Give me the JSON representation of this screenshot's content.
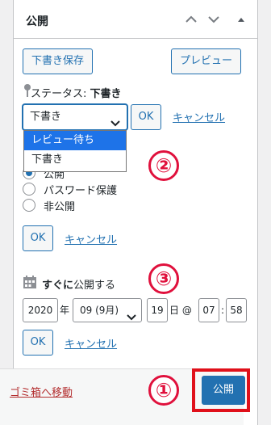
{
  "header": {
    "title": "公開"
  },
  "actions": {
    "save_draft": "下書き保存",
    "preview": "プレビュー"
  },
  "status": {
    "label": "ステータス:",
    "value": "下書き",
    "select_value": "下書き",
    "options": [
      "レビュー待ち",
      "下書き"
    ],
    "ok": "OK",
    "cancel": "キャンセル"
  },
  "visibility": {
    "options": [
      "公開",
      "パスワード保護",
      "非公開"
    ],
    "ok": "OK",
    "cancel": "キャンセル"
  },
  "schedule": {
    "label_bold": "すぐに",
    "label_rest": "公開する",
    "year": "2020",
    "year_suffix": "年",
    "month": "09 (9月)",
    "day": "19",
    "day_suffix": "日 @",
    "hour": "07",
    "colon": ":",
    "minute": "58",
    "ok": "OK",
    "cancel": "キャンセル"
  },
  "footer": {
    "trash": "ゴミ箱へ移動",
    "publish": "公開"
  },
  "annotations": [
    "②",
    "③",
    "①"
  ],
  "colors": {
    "accent": "#2271b1",
    "annotation_red": "#e0103c",
    "highlight_red": "#e0101a"
  }
}
